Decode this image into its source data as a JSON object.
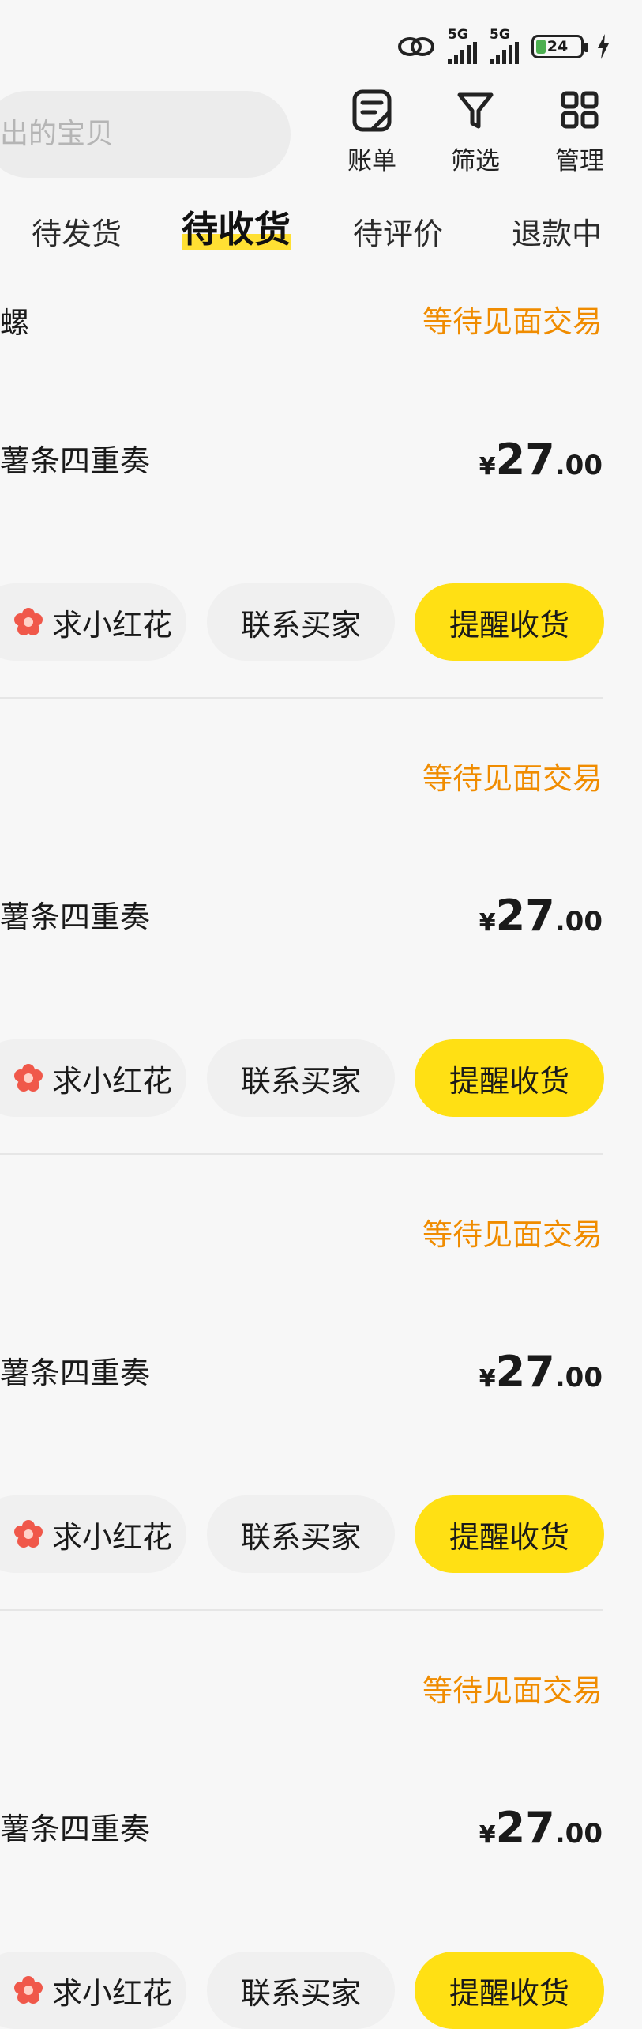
{
  "status_bar": {
    "network_1": "5G",
    "network_2": "5G",
    "battery": "24"
  },
  "search": {
    "placeholder": "出的宝贝"
  },
  "top_actions": [
    {
      "label": "账单",
      "icon": "bill-icon"
    },
    {
      "label": "筛选",
      "icon": "filter-icon"
    },
    {
      "label": "管理",
      "icon": "grid-icon"
    }
  ],
  "tabs": [
    {
      "label": "待发货",
      "active": false
    },
    {
      "label": "待收货",
      "active": true
    },
    {
      "label": "待评价",
      "active": false
    },
    {
      "label": "退款中",
      "active": false
    }
  ],
  "orders": [
    {
      "seller": "螺",
      "status": "等待见面交易",
      "title": "薯条四重奏",
      "price_symbol": "¥",
      "price_int": "27",
      "price_dec": ".00",
      "btn_flower": "求小红花",
      "btn_contact": "联系买家",
      "btn_remind": "提醒收货"
    },
    {
      "seller": "",
      "status": "等待见面交易",
      "title": "薯条四重奏",
      "price_symbol": "¥",
      "price_int": "27",
      "price_dec": ".00",
      "btn_flower": "求小红花",
      "btn_contact": "联系买家",
      "btn_remind": "提醒收货"
    },
    {
      "seller": "",
      "status": "等待见面交易",
      "title": "薯条四重奏",
      "price_symbol": "¥",
      "price_int": "27",
      "price_dec": ".00",
      "btn_flower": "求小红花",
      "btn_contact": "联系买家",
      "btn_remind": "提醒收货"
    },
    {
      "seller": "",
      "status": "等待见面交易",
      "title": "薯条四重奏",
      "price_symbol": "¥",
      "price_int": "27",
      "price_dec": ".00",
      "btn_flower": "求小红花",
      "btn_contact": "联系买家",
      "btn_remind": "提醒收货"
    }
  ],
  "colors": {
    "accent_yellow": "#ffe014",
    "status_orange": "#f08c00",
    "flower_red": "#f0584a"
  }
}
